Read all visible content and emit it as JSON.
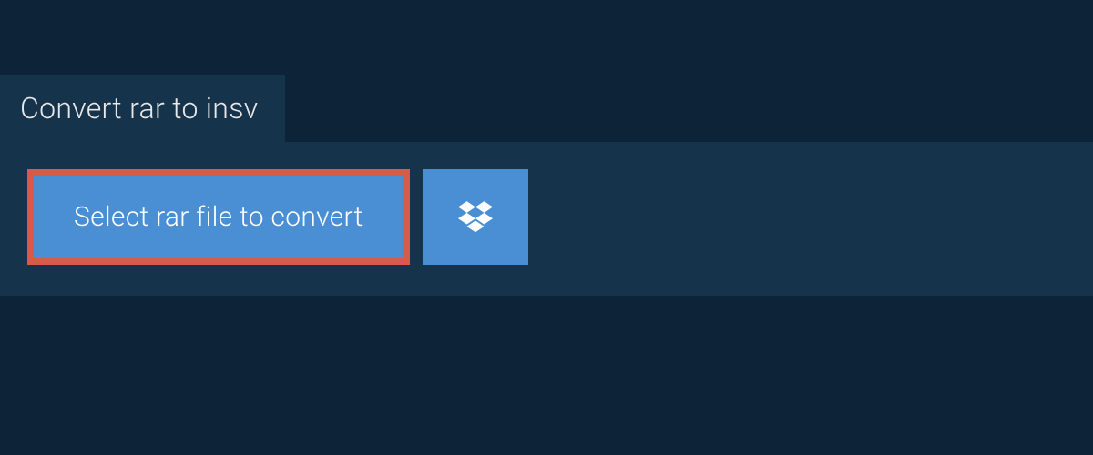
{
  "tab": {
    "title": "Convert rar to insv"
  },
  "actions": {
    "select_file_label": "Select rar file to convert",
    "dropbox_icon": "dropbox-icon"
  },
  "colors": {
    "page_bg": "#0d2438",
    "panel_bg": "#16334c",
    "button_bg": "#4a8fd4",
    "highlight_border": "#d85a4a",
    "text_light": "#e8e8e8",
    "text_white": "#ffffff"
  }
}
